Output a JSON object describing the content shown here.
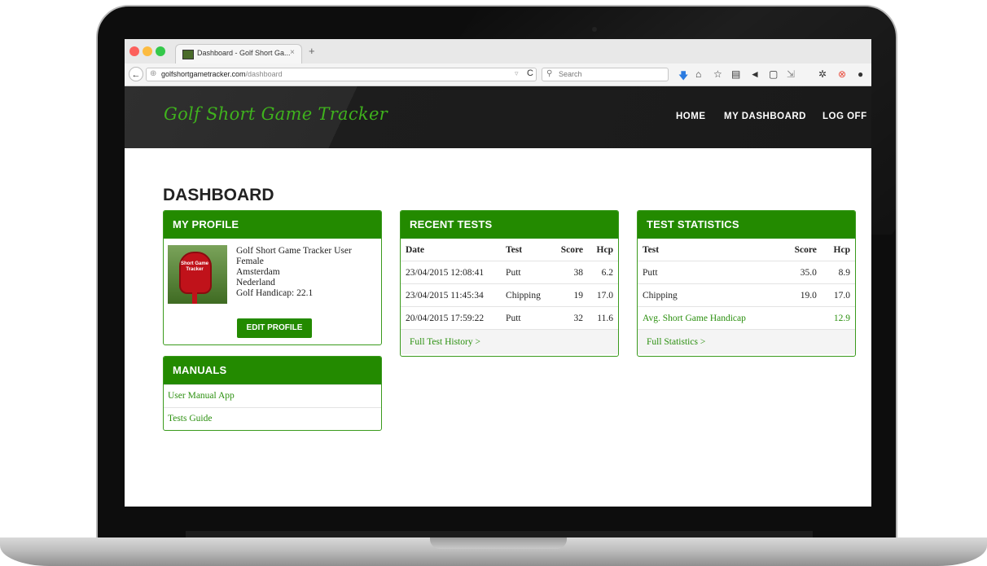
{
  "browser": {
    "tab_title": "Dashboard - Golf Short Ga...",
    "tab_close": "×",
    "new_tab": "+",
    "back": "←",
    "url_domain": "golfshortgametracker.com",
    "url_path": "/dashboard",
    "reload": "C",
    "search_placeholder": "Search",
    "toolbar_icons": [
      "download-icon",
      "home-icon",
      "bookmark-star-icon",
      "reading-list-icon",
      "send-icon",
      "screenshot-icon",
      "extension-icon",
      "settings-icon",
      "help-icon",
      "chat-icon"
    ]
  },
  "site": {
    "brand": "Golf Short Game Tracker",
    "nav": {
      "home": "HOME",
      "dashboard": "MY DASHBOARD",
      "logoff": "LOG OFF"
    }
  },
  "page": {
    "title": "DASHBOARD"
  },
  "profile": {
    "heading": "MY PROFILE",
    "image_label": "Short Game Tracker",
    "name": "Golf Short Game Tracker User",
    "gender": "Female",
    "city": "Amsterdam",
    "country": "Nederland",
    "handicap": "Golf Handicap: 22.1",
    "edit_button": "EDIT PROFILE"
  },
  "manuals": {
    "heading": "MANUALS",
    "items": [
      "User Manual App",
      "Tests Guide"
    ]
  },
  "recent_tests": {
    "heading": "RECENT TESTS",
    "columns": [
      "Date",
      "Test",
      "Score",
      "Hcp"
    ],
    "rows": [
      {
        "date": "23/04/2015 12:08:41",
        "test": "Putt",
        "score": "38",
        "hcp": "6.2"
      },
      {
        "date": "23/04/2015 11:45:34",
        "test": "Chipping",
        "score": "19",
        "hcp": "17.0"
      },
      {
        "date": "20/04/2015 17:59:22",
        "test": "Putt",
        "score": "32",
        "hcp": "11.6"
      }
    ],
    "footer_link": "Full Test History >"
  },
  "statistics": {
    "heading": "TEST STATISTICS",
    "columns": [
      "Test",
      "Score",
      "Hcp"
    ],
    "rows": [
      {
        "test": "Putt",
        "score": "35.0",
        "hcp": "8.9"
      },
      {
        "test": "Chipping",
        "score": "19.0",
        "hcp": "17.0"
      }
    ],
    "average": {
      "label": "Avg. Short Game Handicap",
      "hcp": "12.9"
    },
    "footer_link": "Full Statistics >"
  },
  "colors": {
    "accent": "#238a00",
    "brand_text": "#3fb21d",
    "header_bg": "#1d1d1d"
  }
}
